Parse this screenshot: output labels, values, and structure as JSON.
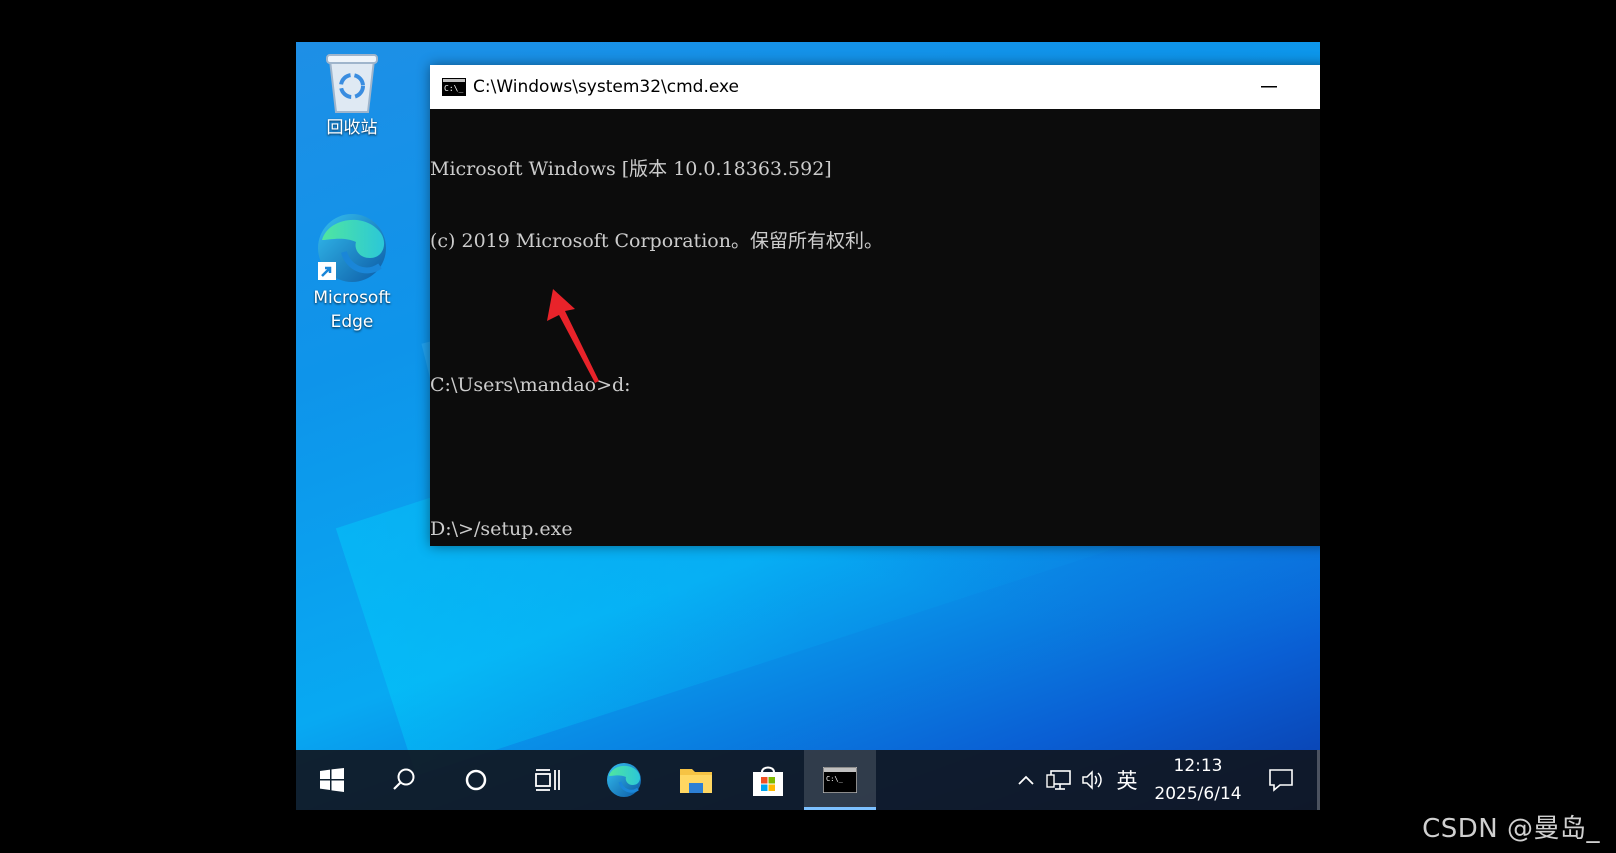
{
  "desktop": {
    "icons": [
      {
        "label": "回收站",
        "icon": "recycle-bin-icon"
      },
      {
        "label": "Microsoft Edge",
        "icon": "edge-icon"
      }
    ]
  },
  "cmd_window": {
    "title": "C:\\Windows\\system32\\cmd.exe",
    "lines": [
      "Microsoft Windows [版本 10.0.18363.592]",
      "(c) 2019 Microsoft Corporation。保留所有权利。",
      "",
      "C:\\Users\\mandao>d:",
      "",
      "D:\\>/setup.exe"
    ],
    "background": "#0c0c0c",
    "text_color": "#cccccc"
  },
  "taskbar": {
    "buttons": [
      "start-icon",
      "search-icon",
      "cortana-icon",
      "task-view-icon",
      "edge-icon",
      "file-explorer-icon",
      "store-icon",
      "cmd-icon"
    ],
    "active": "cmd-icon",
    "tray": {
      "ime": "英",
      "time": "12:13",
      "date": "2025/6/14"
    }
  },
  "annotation": {
    "color": "#e8232a"
  },
  "watermark": "CSDN @曼岛_"
}
